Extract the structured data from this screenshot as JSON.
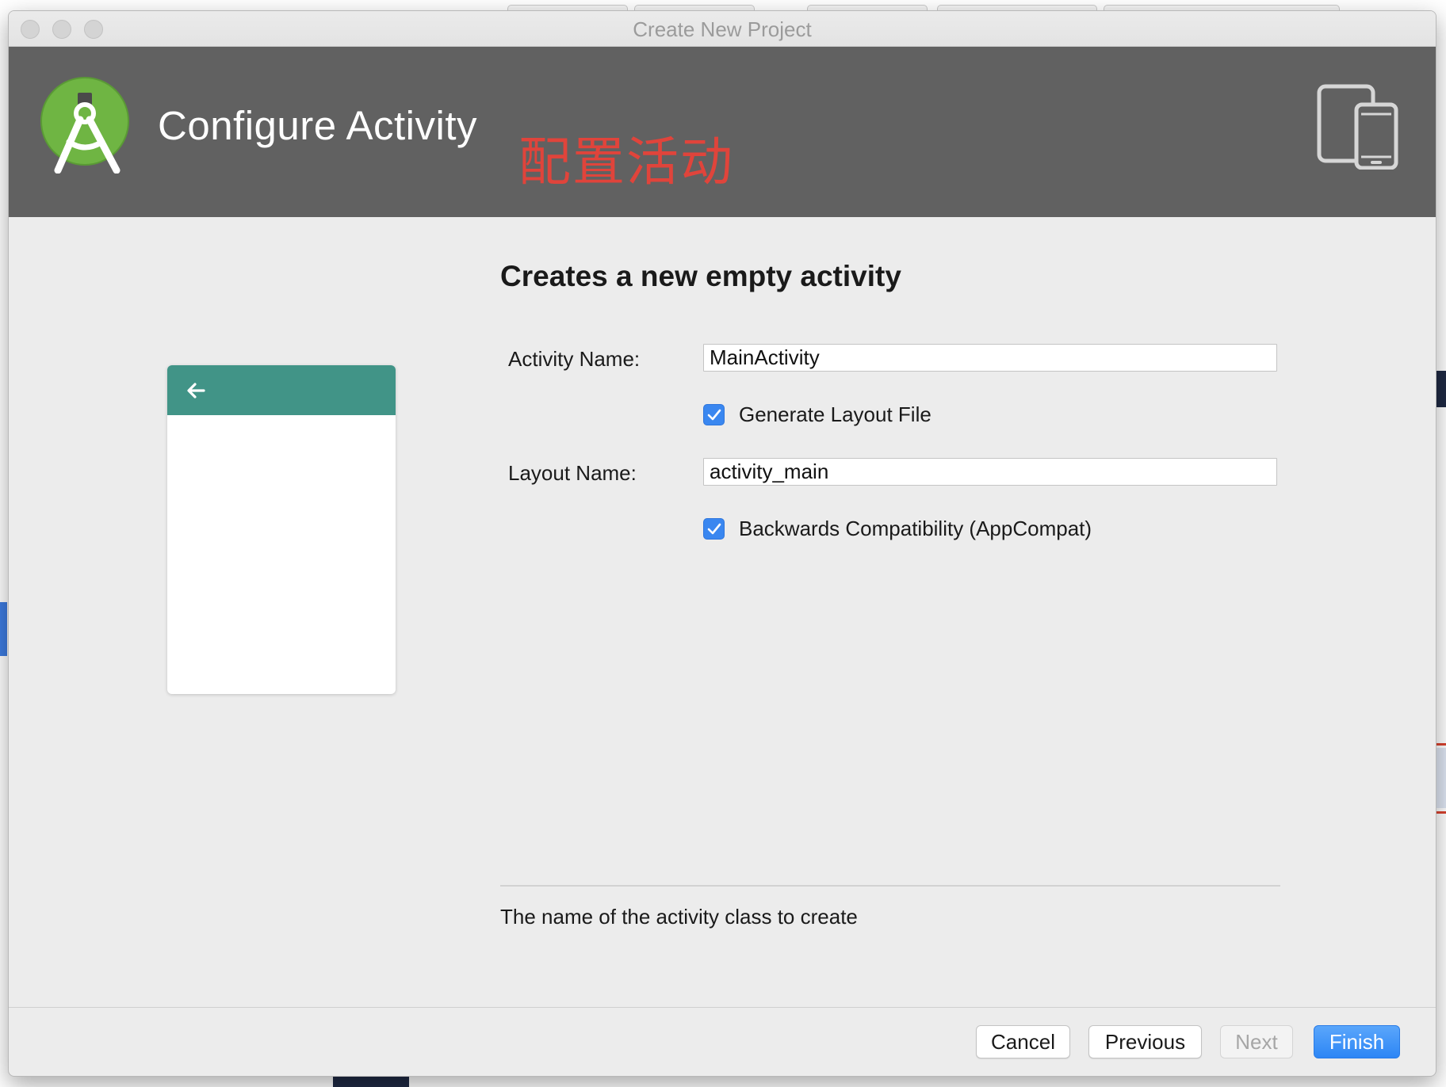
{
  "window": {
    "title": "Create New Project"
  },
  "header": {
    "title": "Configure Activity",
    "annotation": "配置活动",
    "logo_icon": "android-studio-logo-icon",
    "devices_icon": "phone-tablet-devices-icon"
  },
  "preview": {
    "back_icon": "arrow-back-icon",
    "appbar_color": "#419487"
  },
  "form": {
    "heading": "Creates a new empty activity",
    "activity_name": {
      "label": "Activity Name:",
      "value": "MainActivity"
    },
    "generate_layout": {
      "label": "Generate Layout File",
      "checked": true
    },
    "layout_name": {
      "label": "Layout Name:",
      "value": "activity_main"
    },
    "backwards_compat": {
      "label": "Backwards Compatibility (AppCompat)",
      "checked": true
    }
  },
  "help_text": "The name of the activity class to create",
  "buttons": {
    "cancel": "Cancel",
    "previous": "Previous",
    "next": "Next",
    "finish": "Finish"
  },
  "colors": {
    "header_bg": "#616161",
    "accent": "#3a87f0",
    "annotation": "#e0443b"
  }
}
